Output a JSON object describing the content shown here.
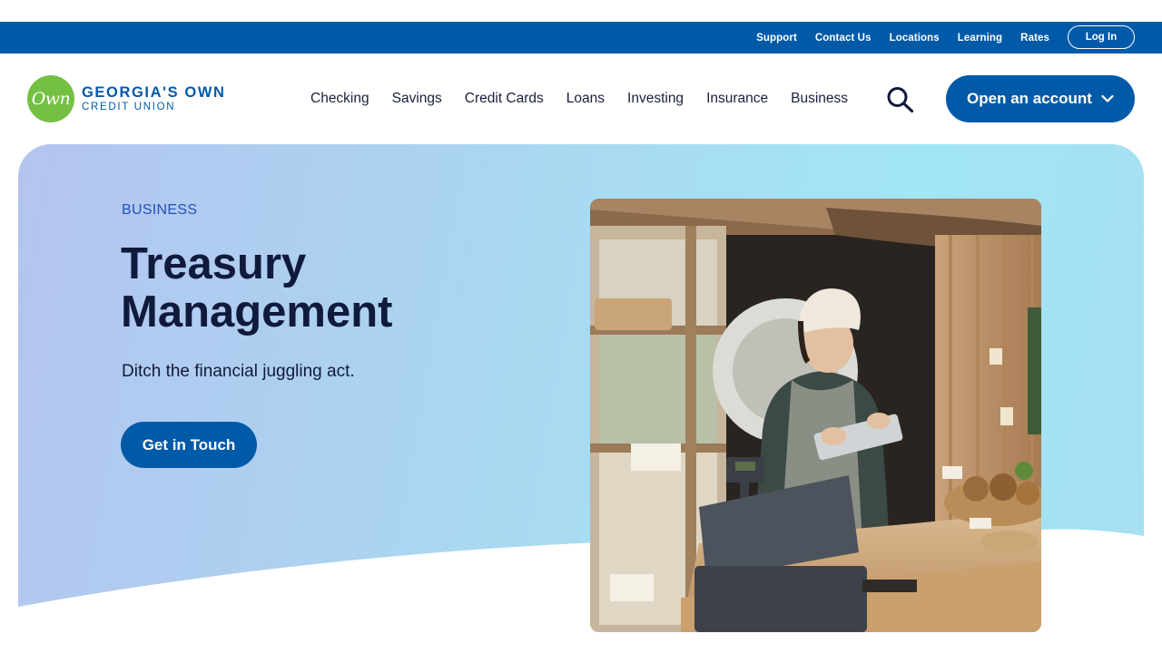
{
  "utility_nav": {
    "links": [
      "Support",
      "Contact Us",
      "Locations",
      "Learning",
      "Rates"
    ],
    "login_label": "Log In"
  },
  "brand": {
    "mark_text": "Own",
    "name_line1": "GEORGIA'S OWN",
    "name_line2": "CREDIT UNION",
    "mark_color": "#74c043",
    "brand_color": "#005aa8"
  },
  "main_nav": {
    "items": [
      "Checking",
      "Savings",
      "Credit Cards",
      "Loans",
      "Investing",
      "Insurance",
      "Business"
    ],
    "search_icon": "search-icon",
    "open_account_label": "Open an account",
    "open_account_icon": "chevron-down-icon"
  },
  "hero": {
    "eyebrow": "BUSINESS",
    "title_line1": "Treasury",
    "title_line2": "Management",
    "subtitle": "Ditch the financial juggling act.",
    "cta_label": "Get in Touch"
  }
}
